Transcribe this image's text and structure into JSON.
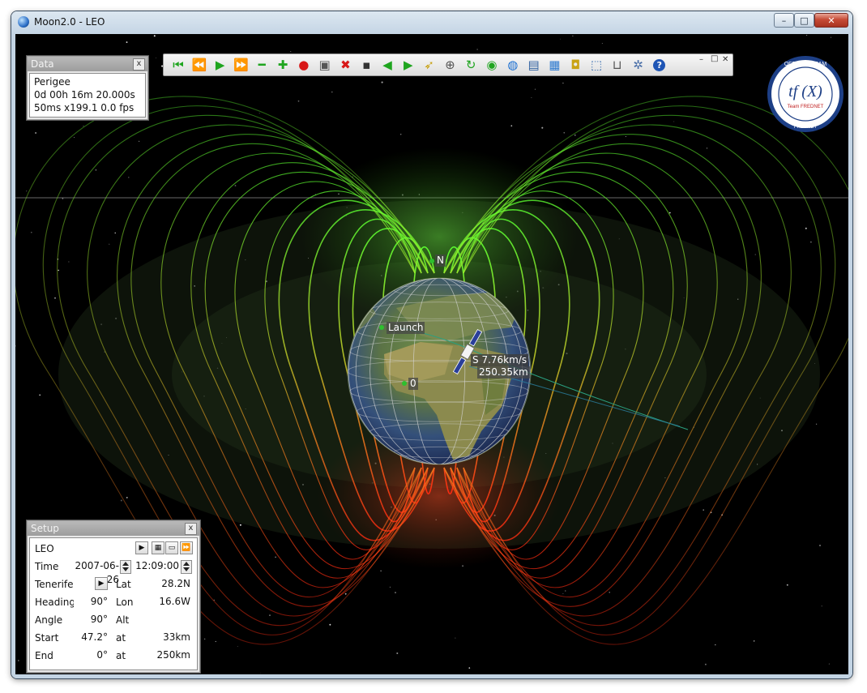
{
  "window": {
    "title": "Moon2.0 - LEO",
    "controls": {
      "minimize": "–",
      "maximize": "□",
      "close": "✕"
    }
  },
  "data_panel": {
    "title": "Data",
    "close_label": "x",
    "lines": [
      "Perigee",
      "0d 00h 16m 20.000s",
      "50ms x199.1 0.0 fps"
    ]
  },
  "toolbar": {
    "buttons": [
      {
        "name": "skip-to-start-icon",
        "glyph": "⏮",
        "color": "#1fa51f"
      },
      {
        "name": "rewind-icon",
        "glyph": "⏪",
        "color": "#1fa51f"
      },
      {
        "name": "play-icon",
        "glyph": "▶",
        "color": "#1fa51f"
      },
      {
        "name": "fast-forward-icon",
        "glyph": "⏩",
        "color": "#1fa51f"
      },
      {
        "name": "minus-icon",
        "glyph": "━",
        "color": "#1fa51f"
      },
      {
        "name": "plus-icon",
        "glyph": "✚",
        "color": "#1fa51f"
      },
      {
        "name": "record-icon",
        "glyph": "●",
        "color": "#d81818"
      },
      {
        "name": "camera-icon",
        "glyph": "▣",
        "color": "#555555"
      },
      {
        "name": "stop-x-icon",
        "glyph": "✖",
        "color": "#d81818"
      },
      {
        "name": "save-icon",
        "glyph": "▪",
        "color": "#333333"
      },
      {
        "name": "step-back-icon",
        "glyph": "◀",
        "color": "#1fa51f"
      },
      {
        "name": "step-forward-icon",
        "glyph": "▶",
        "color": "#1fa51f"
      },
      {
        "name": "rocket-icon",
        "glyph": "➶",
        "color": "#c9a315"
      },
      {
        "name": "satellite-icon",
        "glyph": "⊕",
        "color": "#555555"
      },
      {
        "name": "rotate-icon",
        "glyph": "↻",
        "color": "#1fa51f"
      },
      {
        "name": "globe-up-icon",
        "glyph": "◉",
        "color": "#1fa51f"
      },
      {
        "name": "earth-icon",
        "glyph": "◍",
        "color": "#1b6fd1"
      },
      {
        "name": "window-icon",
        "glyph": "▤",
        "color": "#2d5fa0"
      },
      {
        "name": "picture-icon",
        "glyph": "▦",
        "color": "#2d7ad0"
      },
      {
        "name": "screen-icon",
        "glyph": "◘",
        "color": "#c9a315"
      },
      {
        "name": "export-icon",
        "glyph": "⬚",
        "color": "#3b6fb0"
      },
      {
        "name": "trash-icon",
        "glyph": "⊔",
        "color": "#555555"
      },
      {
        "name": "settings-icon",
        "glyph": "✲",
        "color": "#4a6fa8"
      },
      {
        "name": "help-icon",
        "glyph": "?",
        "color": "#1e55b5"
      }
    ],
    "mini_controls": {
      "minimize": "–",
      "maximize": "□",
      "close": "✕"
    }
  },
  "logo": {
    "top_text": "OFFICIAL TEAM",
    "main_text": "tf (X)",
    "sub_text": "Team FREDNET",
    "bottom_text": "FREDNET"
  },
  "scene": {
    "north_label": "N",
    "launch_label": "Launch",
    "zero_label": "0",
    "south_label": "S",
    "speed": "7.76km/s",
    "altitude": "250.35km"
  },
  "setup_panel": {
    "title": "Setup",
    "close_label": "x",
    "mission": "LEO",
    "time_label": "Time",
    "date": "2007-06-26",
    "clock": "12:09:00",
    "site": "Tenerife",
    "lat_label": "Lat",
    "lat": "28.2N",
    "heading_label": "Heading",
    "heading": "90°",
    "lon_label": "Lon",
    "lon": "16.6W",
    "angle_label": "Angle",
    "angle": "90°",
    "alt_label": "Alt",
    "alt": "",
    "start_label": "Start",
    "start": "47.2°",
    "at_label": "at",
    "start_alt": "33km",
    "end_label": "End",
    "end": "0°",
    "end_alt": "250km"
  }
}
